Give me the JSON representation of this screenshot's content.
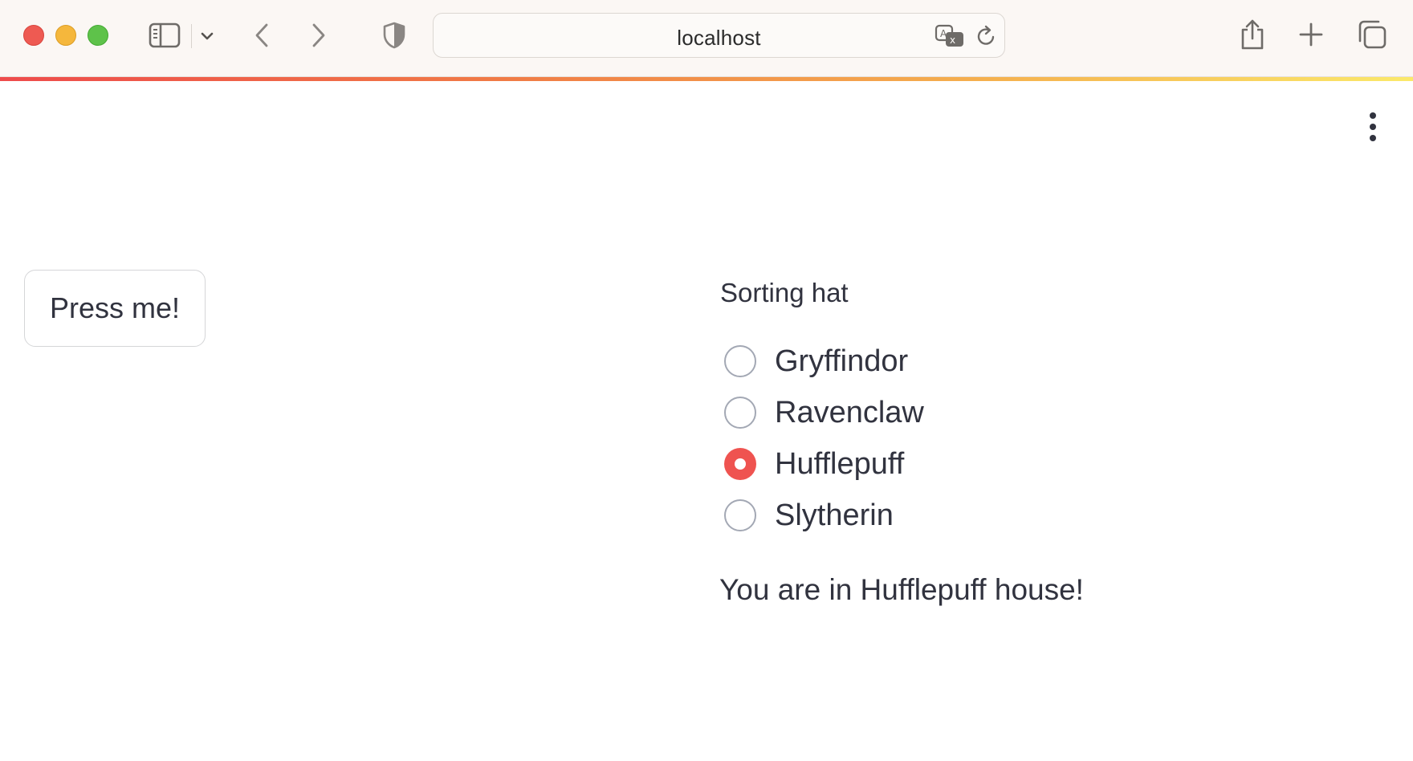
{
  "browser": {
    "url": "localhost",
    "icons": [
      "sidebar-icon",
      "chevron-down-icon",
      "back-icon",
      "forward-icon",
      "shield-icon",
      "translate-icon",
      "reload-icon",
      "share-icon",
      "new-tab-icon",
      "tabs-overview-icon"
    ],
    "colors": {
      "close": "#ee5a52",
      "minimize": "#f5b73c",
      "maximize": "#5ec24a"
    }
  },
  "app": {
    "button_label": "Press me!",
    "radio": {
      "label": "Sorting hat",
      "options": [
        "Gryffindor",
        "Ravenclaw",
        "Hufflepuff",
        "Slytherin"
      ],
      "selected": "Hufflepuff"
    },
    "result": "You are in Hufflepuff house!",
    "accent_color": "#ef5350"
  }
}
